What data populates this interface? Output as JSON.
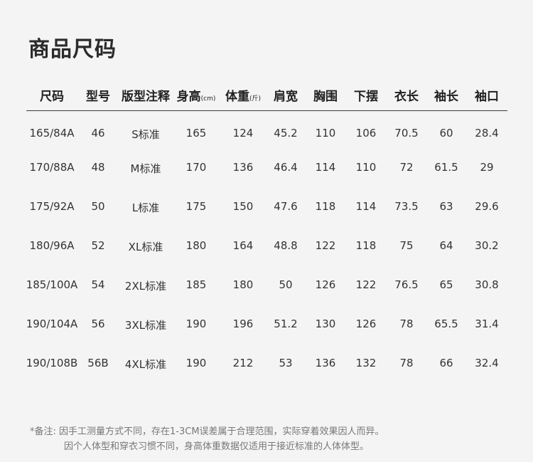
{
  "title": "商品尺码",
  "headers": [
    {
      "label": "尺码",
      "unit": ""
    },
    {
      "label": "型号",
      "unit": ""
    },
    {
      "label": "版型注释",
      "unit": ""
    },
    {
      "label": "身高",
      "unit": "(cm)"
    },
    {
      "label": "体重",
      "unit": "(斤)"
    },
    {
      "label": "肩宽",
      "unit": ""
    },
    {
      "label": "胸围",
      "unit": ""
    },
    {
      "label": "下摆",
      "unit": ""
    },
    {
      "label": "衣长",
      "unit": ""
    },
    {
      "label": "袖长",
      "unit": ""
    },
    {
      "label": "袖口",
      "unit": ""
    }
  ],
  "rows": [
    [
      "165/84A",
      "46",
      "S标准",
      "165",
      "124",
      "45.2",
      "110",
      "106",
      "70.5",
      "60",
      "28.4"
    ],
    [
      "170/88A",
      "48",
      "M标准",
      "170",
      "136",
      "46.4",
      "114",
      "110",
      "72",
      "61.5",
      "29"
    ],
    [
      "175/92A",
      "50",
      "L标准",
      "175",
      "150",
      "47.6",
      "118",
      "114",
      "73.5",
      "63",
      "29.6"
    ],
    [
      "180/96A",
      "52",
      "XL标准",
      "180",
      "164",
      "48.8",
      "122",
      "118",
      "75",
      "64",
      "30.2"
    ],
    [
      "185/100A",
      "54",
      "2XL标准",
      "185",
      "180",
      "50",
      "126",
      "122",
      "76.5",
      "65",
      "30.8"
    ],
    [
      "190/104A",
      "56",
      "3XL标准",
      "190",
      "196",
      "51.2",
      "130",
      "126",
      "78",
      "65.5",
      "31.4"
    ],
    [
      "190/108B",
      "56B",
      "4XL标准",
      "190",
      "212",
      "53",
      "136",
      "132",
      "78",
      "66",
      "32.4"
    ]
  ],
  "note": {
    "line1": "*备注:  因手工测量方式不同，存在1-3CM误差属于合理范围，实际穿着效果因人而异。",
    "line2": "因个人体型和穿衣习惯不同，身高体重数据仅适用于接近标准的人体体型。"
  }
}
